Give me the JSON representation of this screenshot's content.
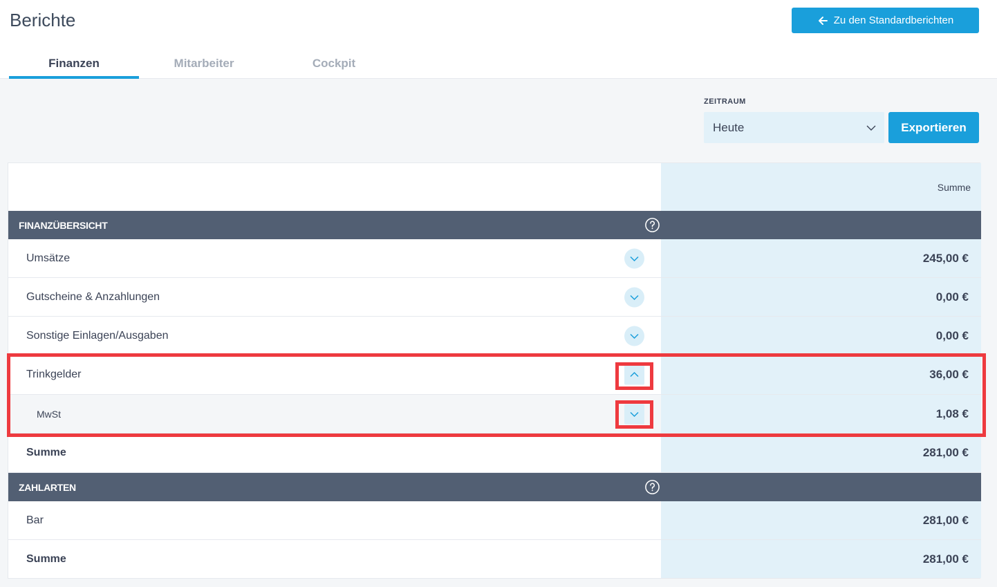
{
  "header": {
    "title": "Berichte",
    "back_button": "Zu den Standardberichten"
  },
  "tabs": [
    {
      "label": "Finanzen",
      "active": true
    },
    {
      "label": "Mitarbeiter",
      "active": false
    },
    {
      "label": "Cockpit",
      "active": false
    }
  ],
  "filter": {
    "label": "ZEITRAUM",
    "selected": "Heute",
    "export_label": "Exportieren"
  },
  "table": {
    "column_header": "Summe",
    "sections": [
      {
        "title": "FINANZÜBERSICHT",
        "rows": [
          {
            "label": "Umsätze",
            "value": "245,00 €",
            "toggle": "collapsed"
          },
          {
            "label": "Gutscheine & Anzahlungen",
            "value": "0,00 €",
            "toggle": "collapsed"
          },
          {
            "label": "Sonstige Einlagen/Ausgaben",
            "value": "0,00 €",
            "toggle": "collapsed"
          },
          {
            "label": "Trinkgelder",
            "value": "36,00 €",
            "toggle": "expanded"
          },
          {
            "label": "MwSt",
            "value": "1,08 €",
            "toggle": "collapsed",
            "sub": true
          },
          {
            "label": "Summe",
            "value": "281,00 €",
            "total": true
          }
        ]
      },
      {
        "title": "ZAHLARTEN",
        "rows": [
          {
            "label": "Bar",
            "value": "281,00 €"
          },
          {
            "label": "Summe",
            "value": "281,00 €",
            "total": true
          }
        ]
      }
    ]
  },
  "colors": {
    "accent": "#1a9fdb",
    "section_header": "#525f73",
    "sum_column": "#e2f1f9",
    "highlight": "#ee3a3f"
  }
}
